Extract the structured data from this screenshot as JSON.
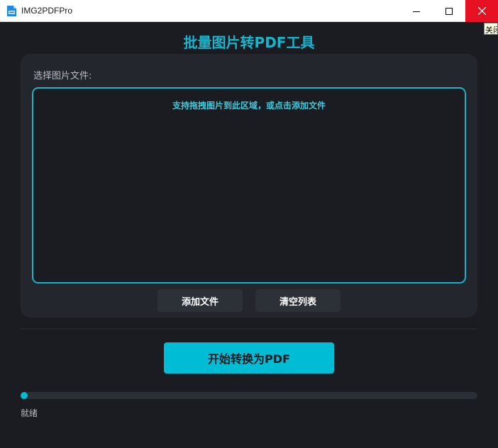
{
  "window": {
    "title": "IMG2PDFPro",
    "close_tooltip": "关闭",
    "icons": {
      "app": "pdf-app-icon",
      "minimize": "minimize-icon",
      "maximize": "maximize-icon",
      "close": "close-icon"
    }
  },
  "header": {
    "title": "批量图片转PDF工具"
  },
  "file_panel": {
    "label": "选择图片文件:",
    "drop_hint": "支持拖拽图片到此区域，或点击添加文件",
    "add_button": "添加文件",
    "clear_button": "清空列表"
  },
  "convert_button": "开始转换为PDF",
  "progress": {
    "value": 0.0
  },
  "status": "就绪",
  "colors": {
    "accent": "#00bcd4",
    "background": "#1a1c22",
    "panel": "#23262c",
    "close_red": "#e81123"
  }
}
